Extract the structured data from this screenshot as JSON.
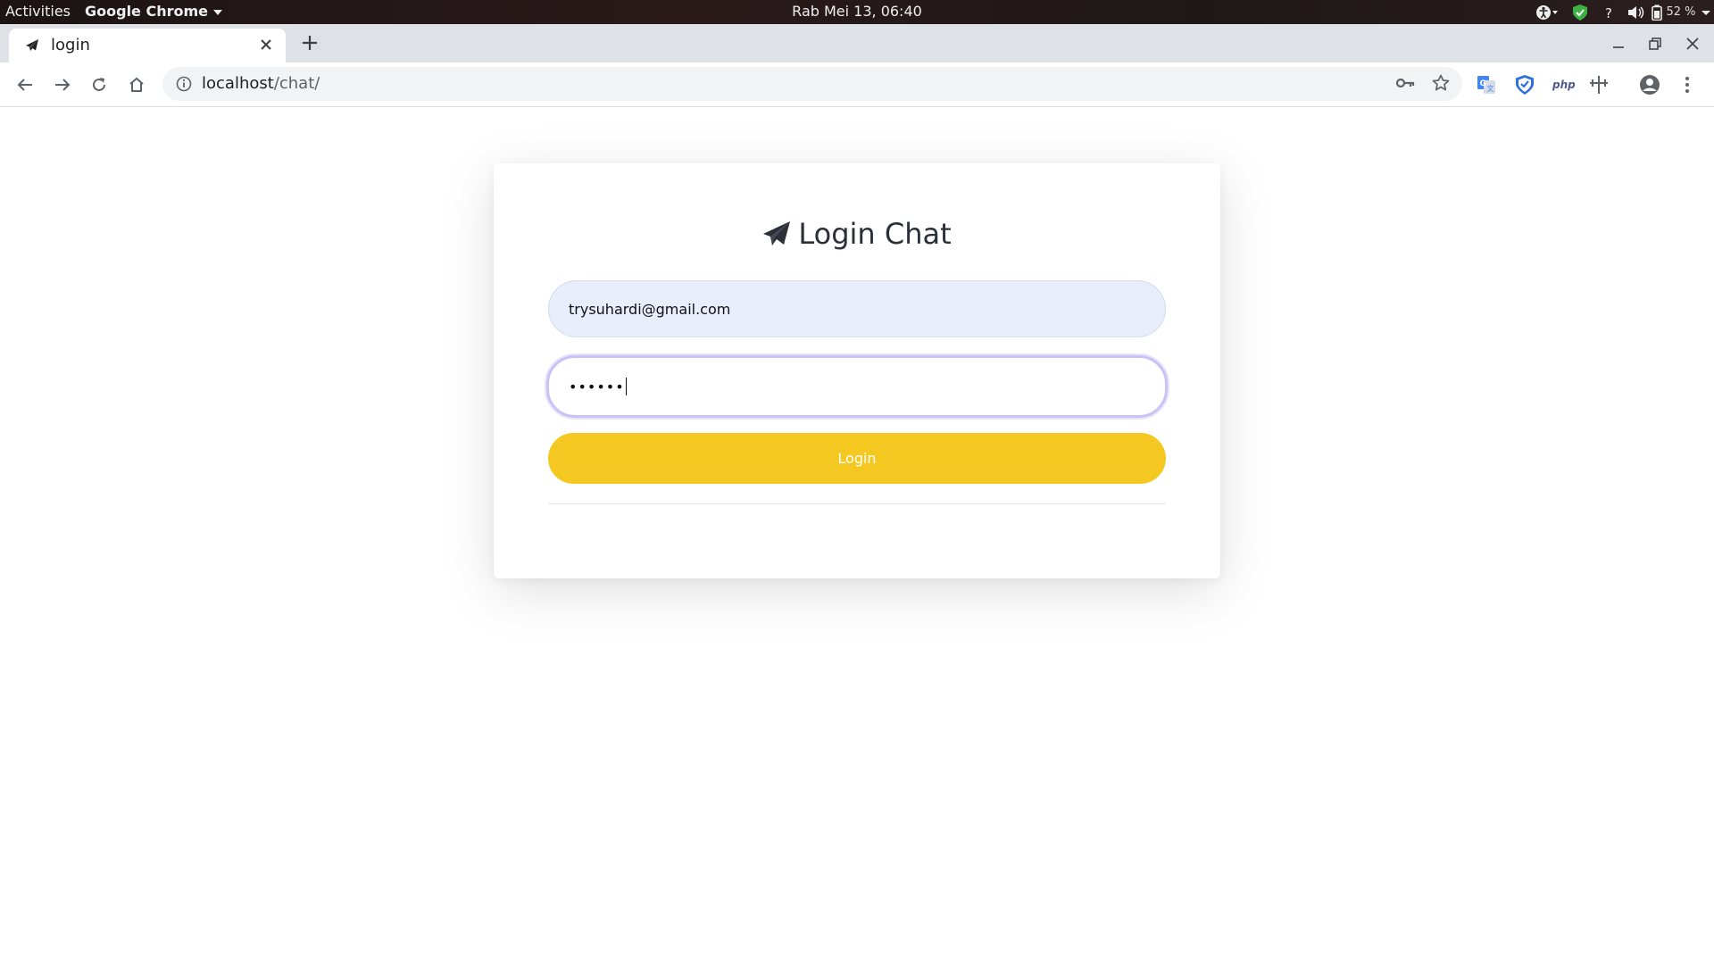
{
  "topbar": {
    "activities": "Activities",
    "app_name": "Google Chrome",
    "clock": "Rab Mei 13, 06:40",
    "battery": "52 %"
  },
  "browser": {
    "tab_title": "login",
    "url_host": "localhost",
    "url_path": "/chat/"
  },
  "login": {
    "heading": "Login Chat",
    "email_value": "trysuhardi@gmail.com",
    "password_masked": "••••••",
    "button_label": "Login",
    "button_color": "#f4c820"
  }
}
